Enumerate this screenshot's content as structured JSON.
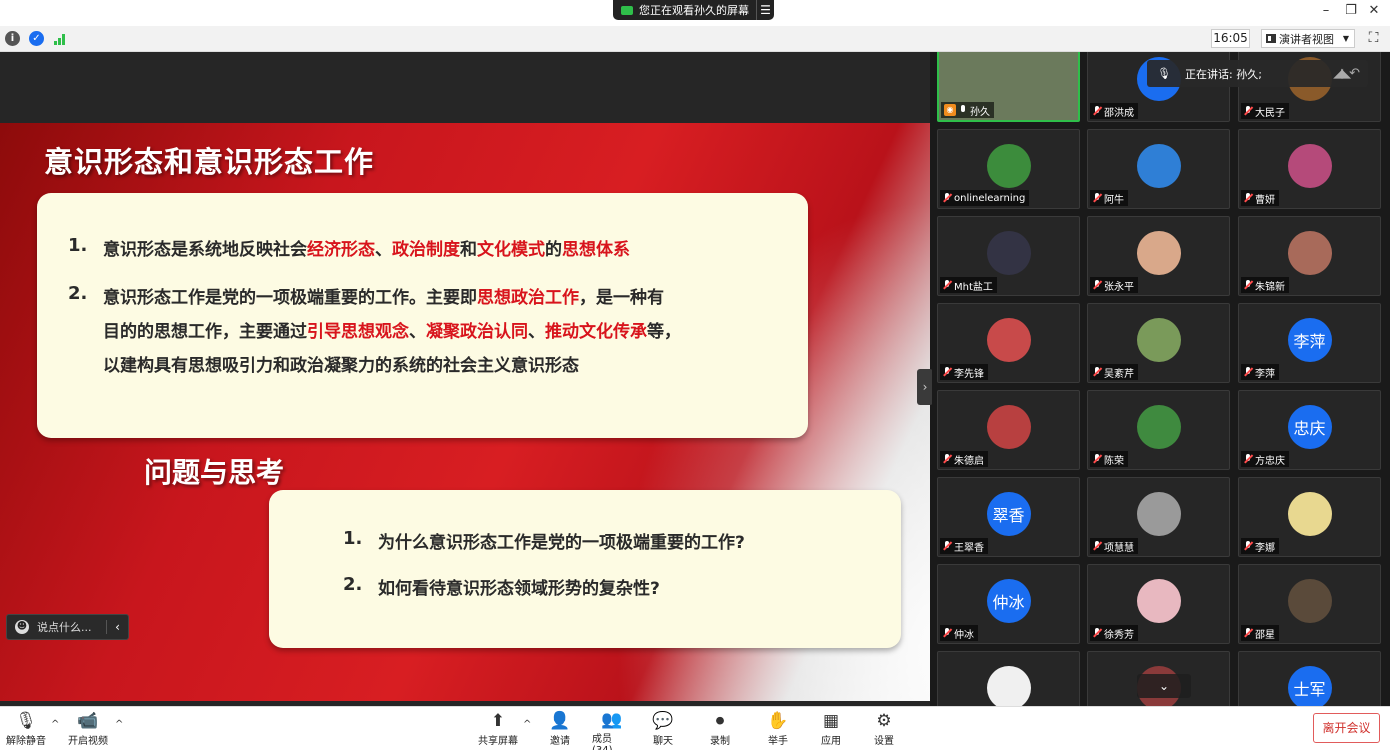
{
  "title_bar": {
    "share_status": "您正在观看孙久的屏幕"
  },
  "info_bar": {
    "clock": "16:05",
    "view_mode": "演讲者视图"
  },
  "slide": {
    "title": "意识形态和意识形态工作",
    "box1": {
      "item1_number": "1.",
      "item1": [
        "意识形态是系统地反映社会",
        "经济形态",
        "、",
        "政治制度",
        "和",
        "文化模式",
        "的",
        "思想体系"
      ],
      "item2_number": "2.",
      "item2_line1": [
        "意识形态工作是党的一项极端重要的工作。主要即",
        "思想政治工作",
        "，是一种有"
      ],
      "item2_line2": [
        "目的的思想工作，主要通过",
        "引导思想观念",
        "、",
        "凝聚政治认同",
        "、",
        "推动文化传承",
        "等，"
      ],
      "item2_line3": "以建构具有思想吸引力和政治凝聚力的系统的社会主义意识形态"
    },
    "subtitle": "问题与思考",
    "box2": {
      "q1_number": "1.",
      "q1": "为什么意识形态工作是党的一项极端重要的工作?",
      "q2_number": "2.",
      "q2": "如何看待意识形态领域形势的复杂性?"
    }
  },
  "chat": {
    "placeholder": "说点什么..."
  },
  "speaking_banner": "正在讲话: 孙久;",
  "participants": [
    {
      "name": "孙久",
      "avatar_text": "",
      "avatar_color": "#6b7a5c",
      "muted": false,
      "active": true
    },
    {
      "name": "邵洪成",
      "avatar_text": "",
      "avatar_color": "#1a6df0",
      "muted": true
    },
    {
      "name": "大民子",
      "avatar_text": "",
      "avatar_color": "#8a5a2a",
      "muted": true
    },
    {
      "name": "onlinelearning",
      "avatar_text": "",
      "avatar_color": "#3c8c3c",
      "muted": true
    },
    {
      "name": "阿牛",
      "avatar_text": "",
      "avatar_color": "#2f7fd6",
      "muted": true
    },
    {
      "name": "曹妍",
      "avatar_text": "",
      "avatar_color": "#b54a7a",
      "muted": true
    },
    {
      "name": "Mht盐工",
      "avatar_text": "",
      "avatar_color": "#333344",
      "muted": true
    },
    {
      "name": "张永平",
      "avatar_text": "",
      "avatar_color": "#d9a88a",
      "muted": true
    },
    {
      "name": "朱锦新",
      "avatar_text": "",
      "avatar_color": "#a86a5a",
      "muted": true
    },
    {
      "name": "李先锋",
      "avatar_text": "",
      "avatar_color": "#c84a4a",
      "muted": true
    },
    {
      "name": "吴紊芹",
      "avatar_text": "",
      "avatar_color": "#7a9a5a",
      "muted": true
    },
    {
      "name": "李萍",
      "avatar_text": "李萍",
      "avatar_color": "#1a6df0",
      "muted": true
    },
    {
      "name": "朱德启",
      "avatar_text": "",
      "avatar_color": "#b84040",
      "muted": true
    },
    {
      "name": "陈荣",
      "avatar_text": "",
      "avatar_color": "#3f8a3f",
      "muted": true
    },
    {
      "name": "方忠庆",
      "avatar_text": "忠庆",
      "avatar_color": "#1a6df0",
      "muted": true
    },
    {
      "name": "王翠香",
      "avatar_text": "翠香",
      "avatar_color": "#1a6df0",
      "muted": true
    },
    {
      "name": "项慧慧",
      "avatar_text": "",
      "avatar_color": "#9a9a9a",
      "muted": true
    },
    {
      "name": "李娜",
      "avatar_text": "",
      "avatar_color": "#e8d890",
      "muted": true
    },
    {
      "name": "仲冰",
      "avatar_text": "仲冰",
      "avatar_color": "#1a6df0",
      "muted": true
    },
    {
      "name": "徐秀芳",
      "avatar_text": "",
      "avatar_color": "#e8b8c0",
      "muted": true
    },
    {
      "name": "邵星",
      "avatar_text": "",
      "avatar_color": "#5a4a3a",
      "muted": true
    },
    {
      "name": "",
      "avatar_text": "",
      "avatar_color": "#f0f0f0",
      "muted": true
    },
    {
      "name": "",
      "avatar_text": "",
      "avatar_color": "#8a3a3a",
      "muted": true
    },
    {
      "name": "",
      "avatar_text": "士军",
      "avatar_color": "#1a6df0",
      "muted": true
    }
  ],
  "toolbar": {
    "unmute": "解除静音",
    "start_video": "开启视频",
    "share_screen": "共享屏幕",
    "invite": "邀请",
    "participants": "成员(34)",
    "chat": "聊天",
    "record": "录制",
    "raise_hand": "举手",
    "apps": "应用",
    "settings": "设置",
    "leave": "离开会议"
  }
}
